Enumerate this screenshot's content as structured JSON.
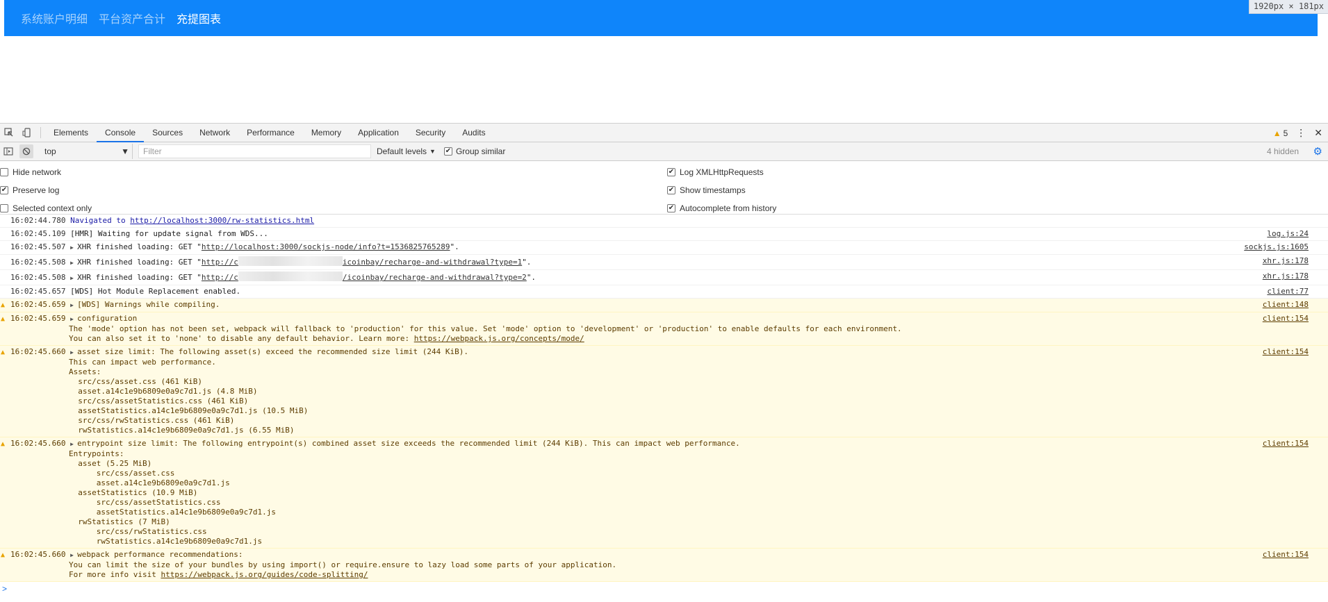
{
  "page": {
    "nav_links": [
      "系统账户明细",
      "平台资产合计",
      "充提图表"
    ],
    "dimension_badge": "1920px × 181px"
  },
  "devtools": {
    "tabs": [
      "Elements",
      "Console",
      "Sources",
      "Network",
      "Performance",
      "Memory",
      "Application",
      "Security",
      "Audits"
    ],
    "active_tab": "Console",
    "warning_count": "5",
    "context": "top",
    "filter_placeholder": "Filter",
    "levels_label": "Default levels",
    "group_similar_label": "Group similar",
    "hidden_count": "4 hidden",
    "settings_left": [
      "Hide network",
      "Preserve log",
      "Selected context only"
    ],
    "settings_right": [
      "Log XMLHttpRequests",
      "Show timestamps",
      "Autocomplete from history"
    ]
  },
  "console": {
    "m1": {
      "ts": "16:02:44.780",
      "text": "Navigated to ",
      "link": "http://localhost:3000/rw-statistics.html"
    },
    "m2": {
      "ts": "16:02:45.109",
      "text": "[HMR] Waiting for update signal from WDS...",
      "src": "log.js:24"
    },
    "m3": {
      "ts": "16:02:45.507",
      "text": "XHR finished loading: GET \"",
      "link": "http://localhost:3000/sockjs-node/info?t=1536825765289",
      "end": "\".",
      "src": "sockjs.js:1605"
    },
    "m4": {
      "ts": "16:02:45.508",
      "text": "XHR finished loading: GET \"",
      "link_a": "http://c",
      "link_b": "icoinbay/recharge-and-withdrawal?type=1",
      "end": "\".",
      "src": "xhr.js:178"
    },
    "m5": {
      "ts": "16:02:45.508",
      "text": "XHR finished loading: GET \"",
      "link_a": "http://c",
      "link_b": "/icoinbay/recharge-and-withdrawal?type=2",
      "end": "\".",
      "src": "xhr.js:178"
    },
    "m6": {
      "ts": "16:02:45.657",
      "text": "[WDS] Hot Module Replacement enabled.",
      "src": "client:77"
    },
    "m7": {
      "ts": "16:02:45.659",
      "text": "[WDS] Warnings while compiling.",
      "src": "client:148"
    },
    "m8": {
      "ts": "16:02:45.659",
      "head": "configuration",
      "src": "client:154",
      "line1": "The 'mode' option has not been set, webpack will fallback to 'production' for this value. Set 'mode' option to 'development' or 'production' to enable defaults for each environment.",
      "line2": "You can also set it to 'none' to disable any default behavior. Learn more: ",
      "link": "https://webpack.js.org/concepts/mode/"
    },
    "m9": {
      "ts": "16:02:45.660",
      "head": "asset size limit: The following asset(s) exceed the recommended size limit (244 KiB).",
      "src": "client:154",
      "lines": [
        "This can impact web performance.",
        "Assets:",
        "  src/css/asset.css (461 KiB)",
        "  asset.a14c1e9b6809e0a9c7d1.js (4.8 MiB)",
        "  src/css/assetStatistics.css (461 KiB)",
        "  assetStatistics.a14c1e9b6809e0a9c7d1.js (10.5 MiB)",
        "  src/css/rwStatistics.css (461 KiB)",
        "  rwStatistics.a14c1e9b6809e0a9c7d1.js (6.55 MiB)"
      ]
    },
    "m10": {
      "ts": "16:02:45.660",
      "head": "entrypoint size limit: The following entrypoint(s) combined asset size exceeds the recommended limit (244 KiB). This can impact web performance.",
      "src": "client:154",
      "lines": [
        "Entrypoints:",
        "  asset (5.25 MiB)",
        "      src/css/asset.css",
        "      asset.a14c1e9b6809e0a9c7d1.js",
        "  assetStatistics (10.9 MiB)",
        "      src/css/assetStatistics.css",
        "      assetStatistics.a14c1e9b6809e0a9c7d1.js",
        "  rwStatistics (7 MiB)",
        "      src/css/rwStatistics.css",
        "      rwStatistics.a14c1e9b6809e0a9c7d1.js"
      ]
    },
    "m11": {
      "ts": "16:02:45.660",
      "head": "webpack performance recommendations:",
      "src": "client:154",
      "line1": "You can limit the size of your bundles by using import() or require.ensure to lazy load some parts of your application.",
      "line2": "For more info visit ",
      "link": "https://webpack.js.org/guides/code-splitting/"
    },
    "prompt": ">"
  }
}
